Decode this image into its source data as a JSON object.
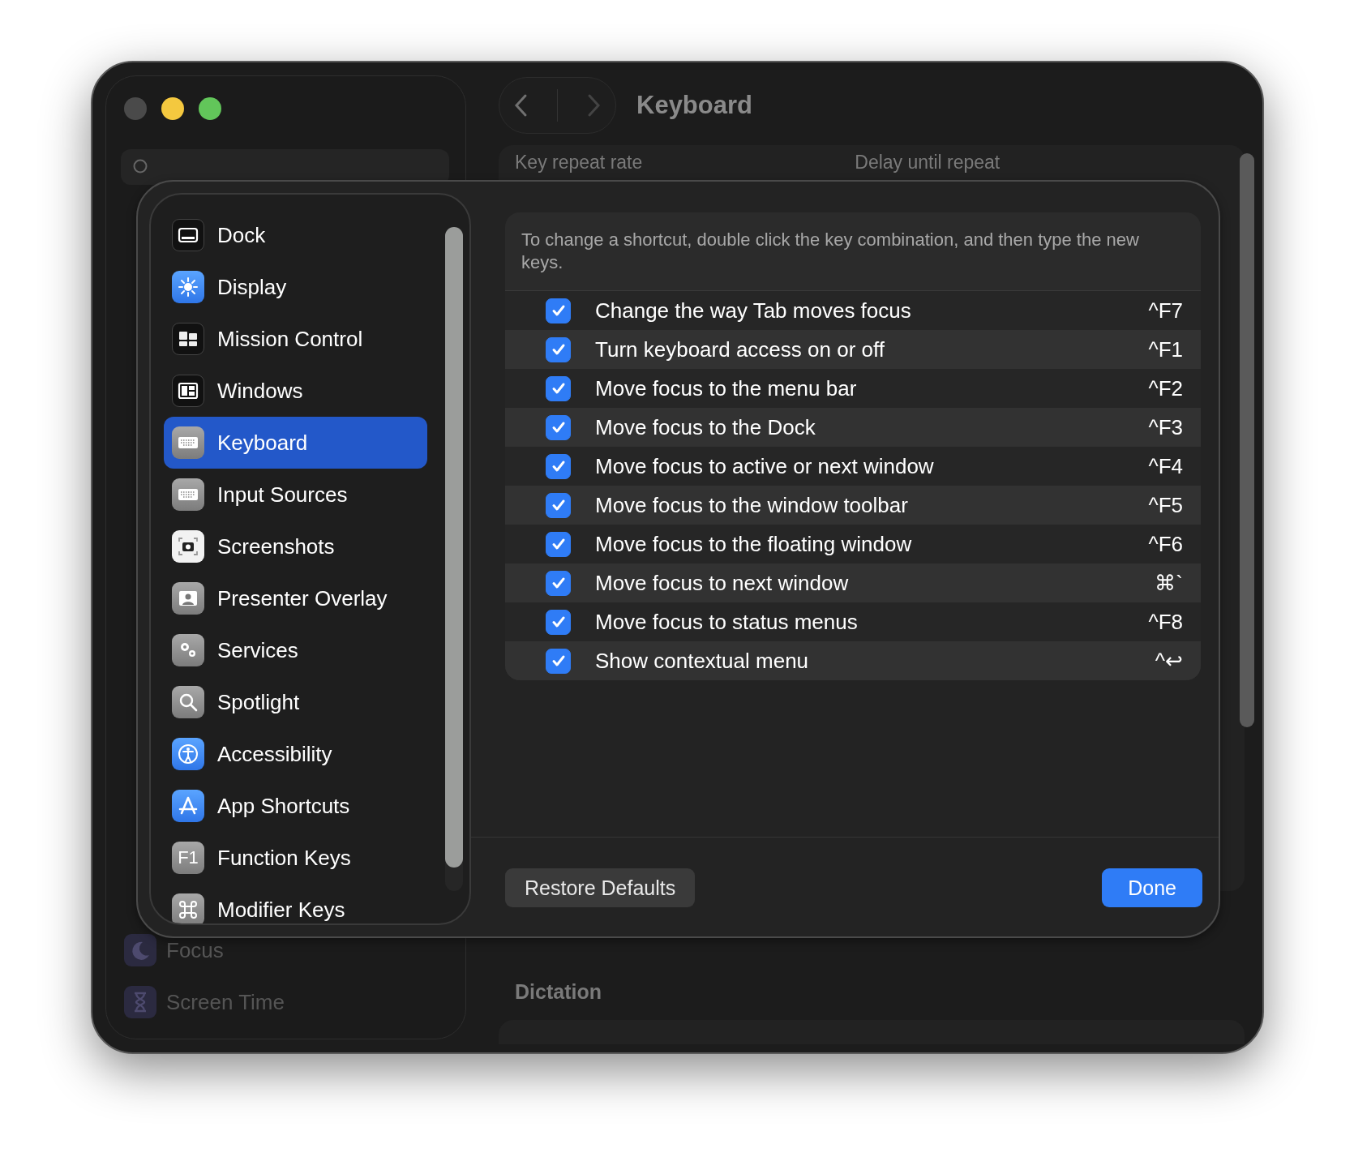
{
  "window": {
    "title": "Keyboard"
  },
  "background": {
    "search_icon": true,
    "sidebar_items": [
      {
        "label": "Focus"
      },
      {
        "label": "Screen Time"
      }
    ],
    "labels": [
      "Key repeat rate",
      "Delay until repeat"
    ],
    "section": "Dictation"
  },
  "sheet": {
    "sidebar": [
      {
        "label": "Dock",
        "selected": false
      },
      {
        "label": "Display",
        "selected": false
      },
      {
        "label": "Mission Control",
        "selected": false
      },
      {
        "label": "Windows",
        "selected": false
      },
      {
        "label": "Keyboard",
        "selected": true
      },
      {
        "label": "Input Sources",
        "selected": false
      },
      {
        "label": "Screenshots",
        "selected": false
      },
      {
        "label": "Presenter Overlay",
        "selected": false
      },
      {
        "label": "Services",
        "selected": false
      },
      {
        "label": "Spotlight",
        "selected": false
      },
      {
        "label": "Accessibility",
        "selected": false
      },
      {
        "label": "App Shortcuts",
        "selected": false
      },
      {
        "label": "Function Keys",
        "selected": false,
        "icon_text": "F1"
      },
      {
        "label": "Modifier Keys",
        "selected": false
      }
    ],
    "hint": "To change a shortcut, double click the key combination, and then type the new keys.",
    "shortcuts": [
      {
        "label": "Change the way Tab moves focus",
        "checked": true,
        "keys": "^F7"
      },
      {
        "label": "Turn keyboard access on or off",
        "checked": true,
        "keys": "^F1"
      },
      {
        "label": "Move focus to the menu bar",
        "checked": true,
        "keys": "^F2"
      },
      {
        "label": "Move focus to the Dock",
        "checked": true,
        "keys": "^F3"
      },
      {
        "label": "Move focus to active or next window",
        "checked": true,
        "keys": "^F4"
      },
      {
        "label": "Move focus to the window toolbar",
        "checked": true,
        "keys": "^F5"
      },
      {
        "label": "Move focus to the floating window",
        "checked": true,
        "keys": "^F6"
      },
      {
        "label": "Move focus to next window",
        "checked": true,
        "keys": "⌘`"
      },
      {
        "label": "Move focus to status menus",
        "checked": true,
        "keys": "^F8"
      },
      {
        "label": "Show contextual menu",
        "checked": true,
        "keys": "^↩"
      }
    ],
    "buttons": {
      "restore": "Restore Defaults",
      "done": "Done"
    }
  }
}
